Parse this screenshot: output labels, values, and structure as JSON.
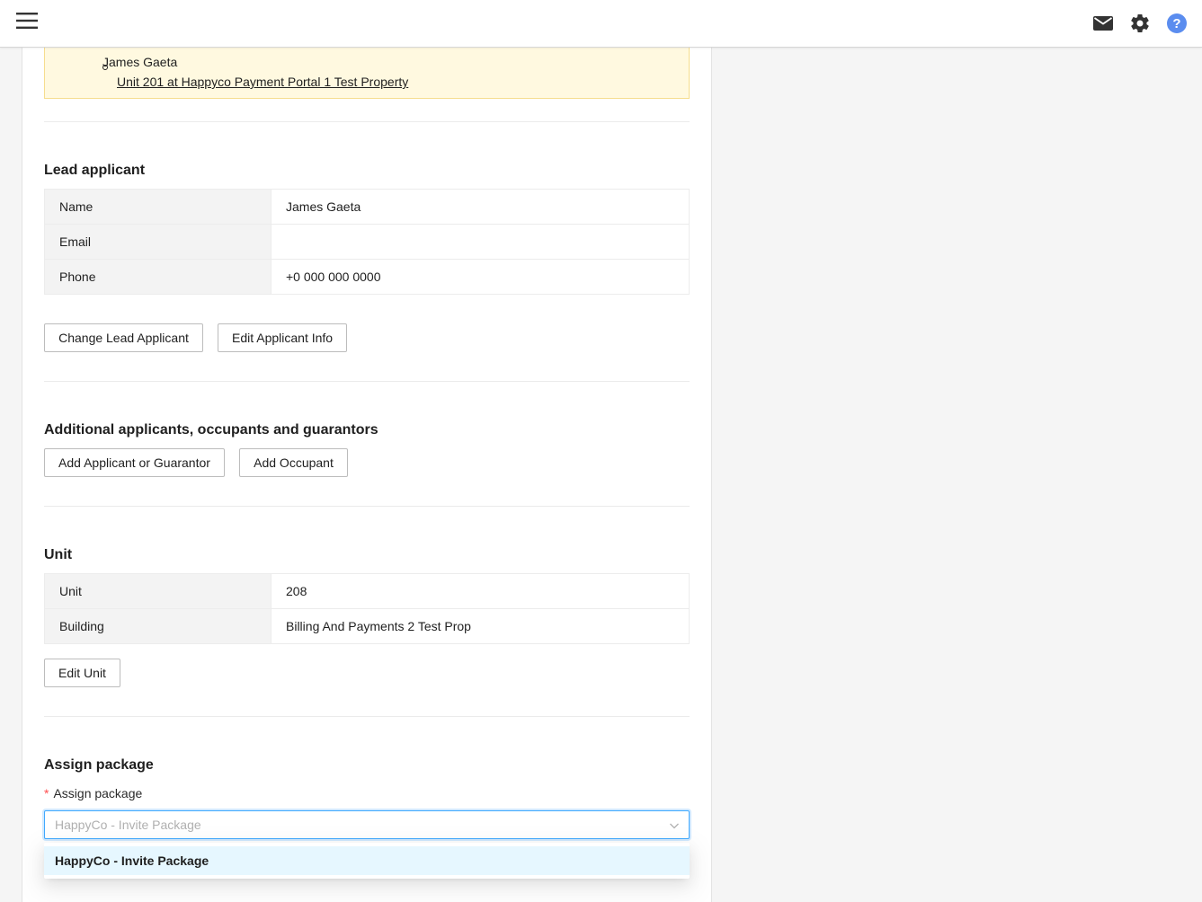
{
  "topbar": {
    "menu_icon": "hamburger-menu-icon",
    "mail_icon": "mail-icon",
    "settings_icon": "gear-icon",
    "help_icon": "help-icon",
    "help_color": "#5b8def"
  },
  "notice": {
    "name": "James Gaeta",
    "unit_link": "Unit 201 at Happyco Payment Portal 1 Test Property"
  },
  "lead_applicant": {
    "title": "Lead applicant",
    "rows": [
      {
        "key": "Name",
        "value": "James Gaeta"
      },
      {
        "key": "Email",
        "value": ""
      },
      {
        "key": "Phone",
        "value": "+0 000 000 0000"
      }
    ],
    "change_button": "Change Lead Applicant",
    "edit_button": "Edit Applicant Info"
  },
  "additional": {
    "title": "Additional applicants, occupants and guarantors",
    "add_applicant_button": "Add Applicant or Guarantor",
    "add_occupant_button": "Add Occupant"
  },
  "unit": {
    "title": "Unit",
    "rows": [
      {
        "key": "Unit",
        "value": "208"
      },
      {
        "key": "Building",
        "value": "Billing And Payments 2 Test Prop"
      }
    ],
    "edit_button": "Edit Unit"
  },
  "assign_package": {
    "title": "Assign package",
    "label": "Assign package",
    "required_mark": "*",
    "placeholder": "HappyCo - Invite Package",
    "options": [
      "HappyCo - Invite Package"
    ]
  }
}
